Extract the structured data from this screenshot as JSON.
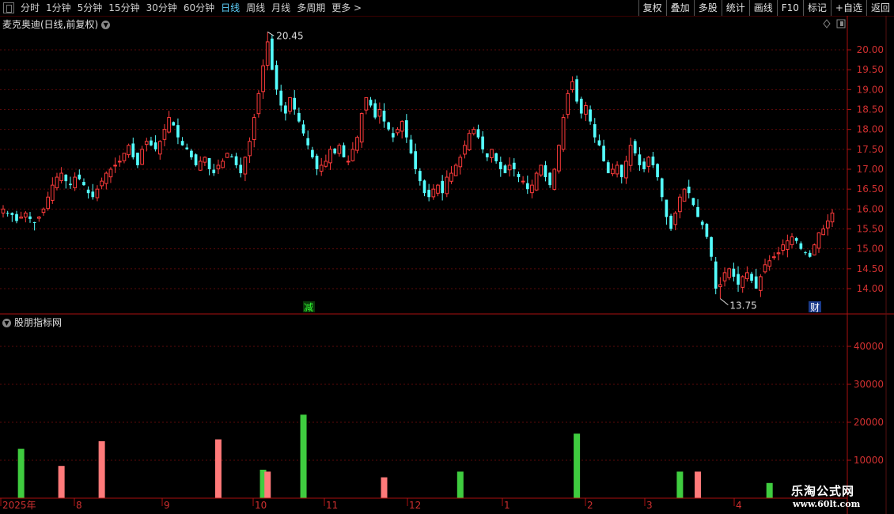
{
  "toolbar": {
    "periods": [
      "分时",
      "1分钟",
      "5分钟",
      "15分钟",
      "30分钟",
      "60分钟",
      "日线",
      "周线",
      "月线",
      "多周期",
      "更多 >"
    ],
    "active": "日线",
    "right_buttons": [
      "复权",
      "叠加",
      "多股",
      "统计",
      "画线",
      "F10",
      "标记",
      "+自选",
      "返回"
    ]
  },
  "chart": {
    "title": "麦克奥迪(日线,前复权)",
    "indicator_title": "股朋指标网",
    "high_label": "20.45",
    "low_label": "13.75",
    "marker_jian": "减",
    "marker_cai": "财",
    "time_labels": [
      "2025年",
      "8",
      "9",
      "10",
      "11",
      "12",
      "1",
      "2",
      "3",
      "4"
    ]
  },
  "chart_data": [
    {
      "type": "candlestick",
      "price_ticks": [
        "20.00",
        "19.50",
        "19.00",
        "18.50",
        "18.00",
        "17.50",
        "17.00",
        "16.50",
        "16.00",
        "15.50",
        "15.00",
        "14.50",
        "14.00"
      ],
      "ylim": [
        13.75,
        20.45
      ],
      "closes": [
        16.0,
        15.9,
        15.85,
        15.7,
        15.8,
        15.9,
        15.75,
        15.65,
        15.8,
        16.0,
        16.3,
        16.6,
        16.8,
        16.9,
        16.7,
        16.6,
        16.8,
        16.75,
        16.6,
        16.4,
        16.3,
        16.5,
        16.7,
        16.9,
        17.0,
        17.1,
        17.2,
        17.4,
        17.6,
        17.3,
        17.1,
        17.5,
        17.7,
        17.6,
        17.5,
        17.7,
        18.0,
        18.3,
        18.1,
        17.8,
        17.6,
        17.5,
        17.3,
        17.1,
        17.2,
        17.3,
        17.0,
        16.9,
        17.1,
        17.2,
        17.4,
        17.3,
        17.1,
        16.9,
        17.3,
        17.7,
        18.3,
        18.9,
        19.6,
        20.2,
        19.5,
        19.0,
        18.6,
        18.4,
        18.8,
        18.5,
        18.2,
        17.9,
        17.6,
        17.3,
        17.0,
        17.1,
        17.2,
        17.5,
        17.4,
        17.6,
        17.3,
        17.2,
        17.5,
        17.8,
        18.4,
        18.8,
        18.6,
        18.3,
        18.5,
        18.2,
        18.0,
        17.8,
        18.0,
        18.2,
        17.8,
        17.4,
        17.0,
        16.7,
        16.4,
        16.3,
        16.5,
        16.6,
        16.4,
        16.8,
        16.9,
        17.1,
        17.3,
        17.6,
        17.9,
        18.0,
        17.8,
        17.5,
        17.3,
        17.5,
        17.2,
        17.0,
        16.9,
        17.1,
        17.0,
        16.8,
        16.7,
        16.5,
        16.6,
        16.9,
        17.1,
        16.8,
        16.6,
        17.0,
        17.6,
        18.3,
        18.9,
        19.2,
        18.7,
        18.4,
        18.6,
        18.2,
        17.8,
        17.6,
        17.2,
        16.9,
        17.0,
        17.1,
        16.8,
        17.2,
        17.6,
        17.4,
        17.1,
        17.0,
        17.3,
        17.1,
        16.8,
        16.3,
        15.8,
        15.5,
        15.9,
        16.3,
        16.5,
        16.4,
        16.1,
        15.8,
        15.6,
        15.3,
        14.8,
        14.0,
        14.1,
        14.4,
        14.5,
        14.3,
        14.1,
        14.3,
        14.4,
        14.2,
        14.0,
        14.3,
        14.6,
        14.7,
        14.8,
        14.9,
        15.1,
        15.2,
        15.3,
        15.2,
        15.0,
        14.9,
        14.8,
        15.1,
        15.4,
        15.5,
        15.7,
        15.9
      ],
      "volume_ticks": [
        "40000",
        "30000",
        "20000",
        "10000"
      ],
      "volume_bars": [
        {
          "date_index": 4,
          "value": 13000,
          "color": "green"
        },
        {
          "date_index": 13,
          "value": 8500,
          "color": "red"
        },
        {
          "date_index": 22,
          "value": 15000,
          "color": "red"
        },
        {
          "date_index": 48,
          "value": 15500,
          "color": "red"
        },
        {
          "date_index": 58,
          "value": 7500,
          "color": "green"
        },
        {
          "date_index": 59,
          "value": 7000,
          "color": "red"
        },
        {
          "date_index": 67,
          "value": 22000,
          "color": "green"
        },
        {
          "date_index": 85,
          "value": 5500,
          "color": "red"
        },
        {
          "date_index": 102,
          "value": 7000,
          "color": "green"
        },
        {
          "date_index": 128,
          "value": 17000,
          "color": "green"
        },
        {
          "date_index": 151,
          "value": 7000,
          "color": "green"
        },
        {
          "date_index": 155,
          "value": 7000,
          "color": "red"
        },
        {
          "date_index": 171,
          "value": 4000,
          "color": "green"
        }
      ]
    }
  ]
}
